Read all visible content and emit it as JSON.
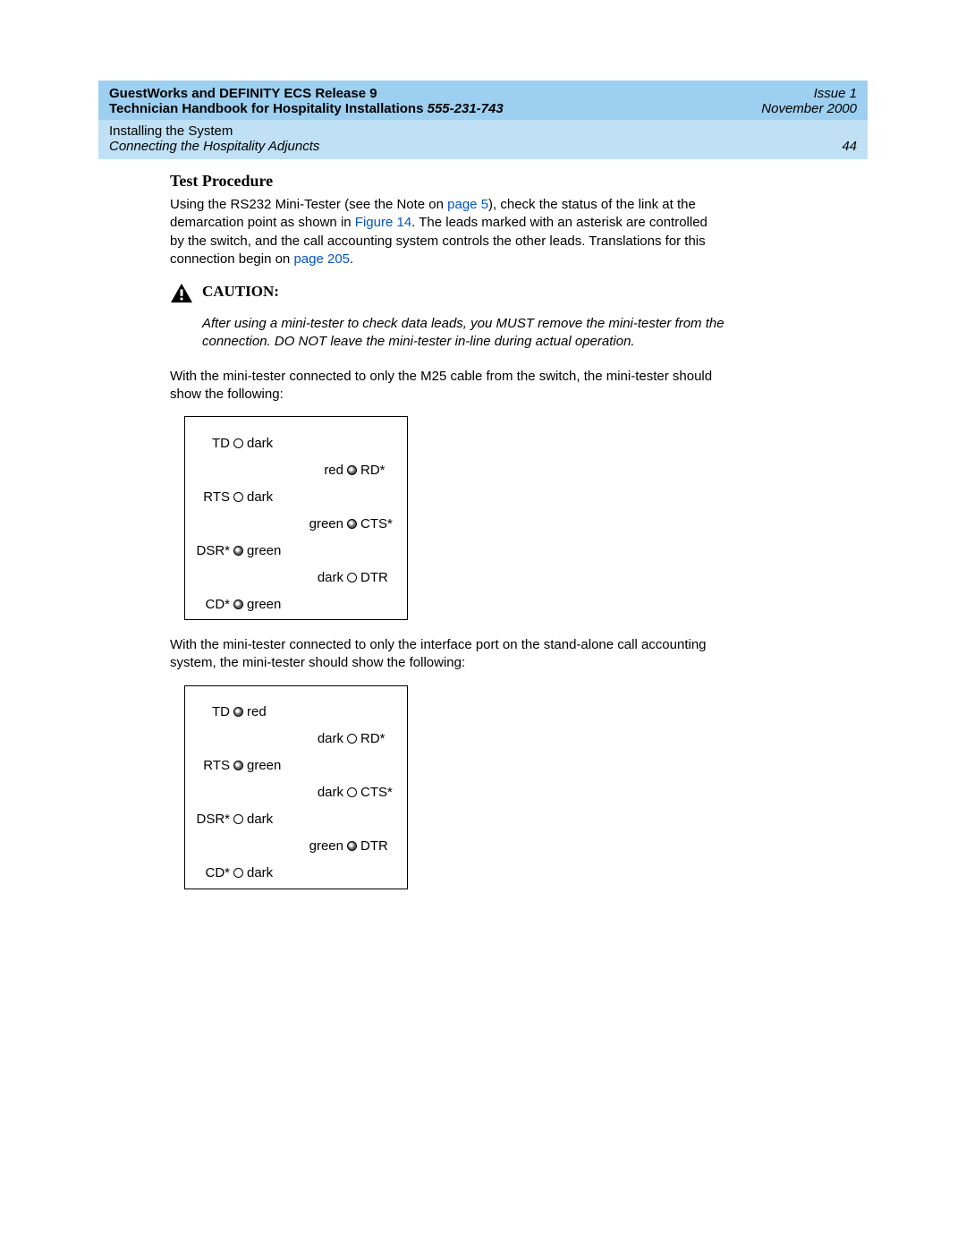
{
  "header": {
    "title_line1": "GuestWorks and DEFINITY ECS Release 9",
    "title_line2_a": "Technician Handbook for Hospitality Installations  ",
    "title_line2_b": "555-231-743",
    "issue": "Issue 1",
    "date": "November 2000",
    "section_top": "Installing the System",
    "section_sub": "Connecting the Hospitality Adjuncts",
    "page_num": "44"
  },
  "body": {
    "heading": "Test Procedure",
    "para1_a": "Using the RS232 Mini-Tester (see the Note on ",
    "para1_link1": "page 5",
    "para1_b": "), check the status of the link at the demarcation point as shown in ",
    "para1_link2": "Figure 14",
    "para1_c": ". The leads marked with an asterisk are controlled by the switch, and the call accounting system controls the other leads. Translations for this connection begin on ",
    "para1_link3": "page 205",
    "para1_d": ".",
    "caution_label": "CAUTION:",
    "caution_text": "After using a mini-tester to check data leads, you MUST remove the mini-tester from the connection. DO NOT leave the mini-tester in-line during actual operation.",
    "para2": "With the mini-tester connected to only the M25 cable from the switch, the mini-tester should show the following:",
    "para3": "With the mini-tester connected to only the interface port on the stand-alone call accounting system, the mini-tester should show the following:"
  },
  "tester1": {
    "left": [
      {
        "pin": "TD",
        "state": "dark",
        "lit": false
      },
      {
        "pin": "RTS",
        "state": "dark",
        "lit": false
      },
      {
        "pin": "DSR*",
        "state": "green",
        "lit": true
      },
      {
        "pin": "CD*",
        "state": "green",
        "lit": true
      }
    ],
    "right": [
      {
        "pin": "RD*",
        "state": "red",
        "lit": true
      },
      {
        "pin": "CTS*",
        "state": "green",
        "lit": true
      },
      {
        "pin": "DTR",
        "state": "dark",
        "lit": false
      }
    ]
  },
  "tester2": {
    "left": [
      {
        "pin": "TD",
        "state": "red",
        "lit": true
      },
      {
        "pin": "RTS",
        "state": "green",
        "lit": true
      },
      {
        "pin": "DSR*",
        "state": "dark",
        "lit": false
      },
      {
        "pin": "CD*",
        "state": "dark",
        "lit": false
      }
    ],
    "right": [
      {
        "pin": "RD*",
        "state": "dark",
        "lit": false
      },
      {
        "pin": "CTS*",
        "state": "dark",
        "lit": false
      },
      {
        "pin": "DTR",
        "state": "green",
        "lit": true
      }
    ]
  }
}
